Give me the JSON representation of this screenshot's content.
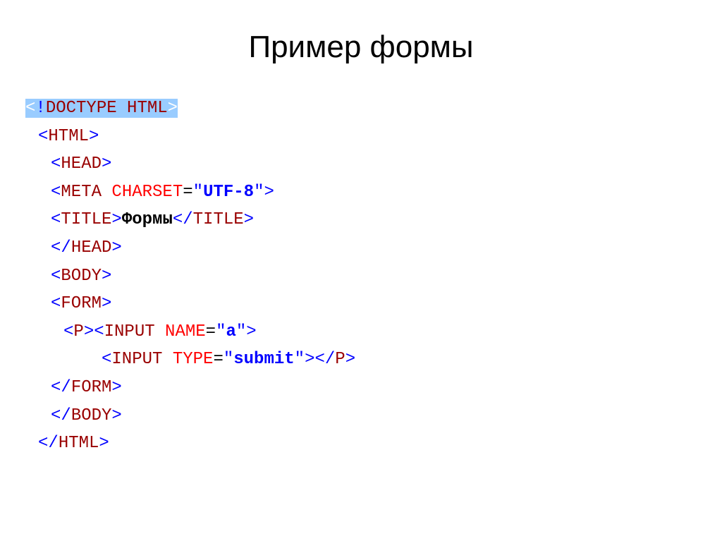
{
  "title": "Пример формы",
  "code": {
    "l1_open": "<",
    "l1_bang": "!",
    "l1_doctype": "DOCTYPE",
    "l1_space": " ",
    "l1_html": "HTML",
    "l1_close": ">",
    "l2_open": "<",
    "l2_tag": "HTML",
    "l2_close": ">",
    "l3_open": "<",
    "l3_tag": "HEAD",
    "l3_close": ">",
    "l4_open": "<",
    "l4_tag": "META",
    "l4_space": " ",
    "l4_attr": "CHARSET",
    "l4_eq": "=",
    "l4_q1": "\"",
    "l4_val": "UTF-8",
    "l4_q2": "\"",
    "l4_close": ">",
    "l5_open": "<",
    "l5_tag": "TITLE",
    "l5_close": ">",
    "l5_text": "Формы",
    "l5_open2": "<",
    "l5_slash": "/",
    "l5_tag2": "TITLE",
    "l5_close2": ">",
    "l6_open": "<",
    "l6_slash": "/",
    "l6_tag": "HEAD",
    "l6_close": ">",
    "l7_open": "<",
    "l7_tag": "BODY",
    "l7_close": ">",
    "l8_open": "<",
    "l8_tag": "FORM",
    "l8_close": ">",
    "l9_open": "<",
    "l9_ptag": "P",
    "l9_close": ">",
    "l9_open2": "<",
    "l9_input": "INPUT",
    "l9_space": " ",
    "l9_attr": "NAME",
    "l9_eq": "=",
    "l9_q1": "\"",
    "l9_val": "a",
    "l9_q2": "\"",
    "l9_close2": ">",
    "l10_open": "<",
    "l10_tag": "INPUT",
    "l10_space": " ",
    "l10_attr": "TYPE",
    "l10_eq": "=",
    "l10_q1": "\"",
    "l10_val": "submit",
    "l10_q2": "\"",
    "l10_close": ">",
    "l10_open2": "<",
    "l10_slash": "/",
    "l10_ptag": "P",
    "l10_close2": ">",
    "l11_open": "<",
    "l11_slash": "/",
    "l11_tag": "FORM",
    "l11_close": ">",
    "l12_open": "<",
    "l12_slash": "/",
    "l12_tag": "BODY",
    "l12_close": ">",
    "l13_open": "<",
    "l13_slash": "/",
    "l13_tag": "HTML",
    "l13_close": ">"
  }
}
